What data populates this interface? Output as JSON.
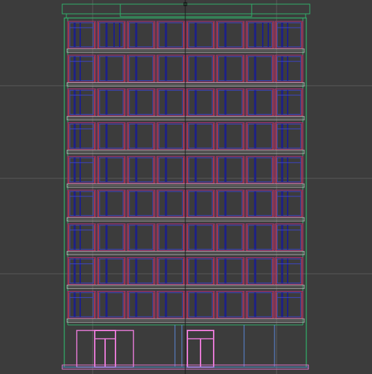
{
  "viewport": {
    "name": "cad-elevation-view",
    "background": "#3c3c3c",
    "colors": {
      "crosshair": "#1a1a1a",
      "grid": "#5a5a5a",
      "outline": "#2fb36b",
      "mullion_dark": "#1c1f8a",
      "mullion_light": "#3d45c8",
      "frame_magenta": "#b0307a",
      "frame_red": "#c43a3a",
      "ledge_gray": "#a8a8a8",
      "door_pink": "#e77ad6",
      "base_blue": "#5b8be0"
    },
    "building": {
      "floors": 9,
      "window_bays_per_floor": 8,
      "entrance_doors": 2
    }
  }
}
